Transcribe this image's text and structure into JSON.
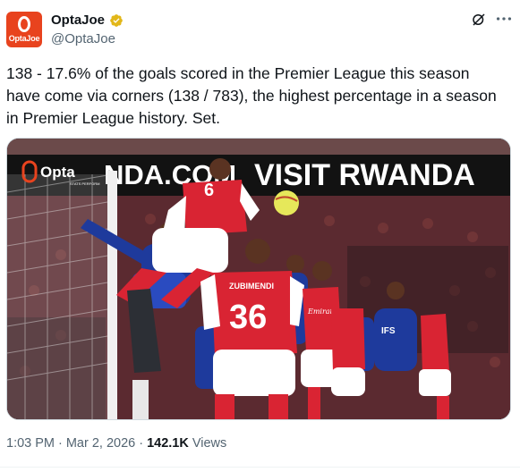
{
  "author": {
    "display_name": "OptaJoe",
    "handle": "@OptaJoe",
    "avatar_text": "OptaJoe",
    "avatar_color": "#e8431e",
    "verified_color": "#e2b719"
  },
  "tweet": {
    "text": "138 - 17.6% of the goals scored in the Premier League this season have come via corners (138 / 783), the highest percentage in a season in Premier League history. Set."
  },
  "media": {
    "banner_text": "VISIT RWANDA",
    "banner_partial": "NDA.COM",
    "logo_text": "Opta",
    "logo_subtext": "STATS PERFORM",
    "player_number_front": "36",
    "player_name_front": "ZUBIMENDI",
    "player_number_jumping": "6",
    "sponsor_text": "Emirates",
    "away_sponsor": "IFS"
  },
  "meta": {
    "time": "1:03 PM",
    "date": "Mar 2, 2026",
    "views_count": "142.1K",
    "views_label": "Views",
    "separator": "·"
  },
  "icons": {
    "grok": "grok-icon",
    "more": "more-icon",
    "verified": "verified-badge-icon"
  }
}
